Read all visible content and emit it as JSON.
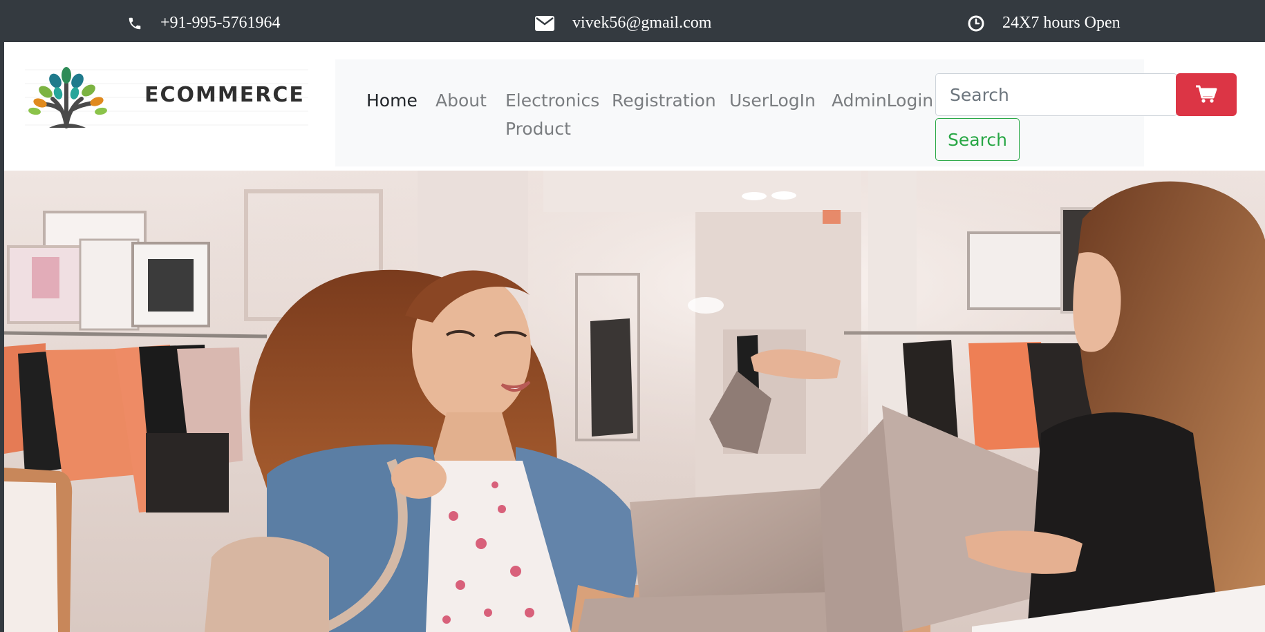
{
  "topbar": {
    "phone": {
      "icon": "phone-icon",
      "text": "+91-995-5761964"
    },
    "email": {
      "icon": "envelope-icon",
      "text": "vivek56@gmail.com"
    },
    "hours": {
      "icon": "clock-icon",
      "text": "24X7 hours Open"
    }
  },
  "brand": {
    "logo_text": "ECOMMERCE"
  },
  "nav": {
    "items": [
      {
        "label": "Home",
        "active": true
      },
      {
        "label": "About",
        "active": false
      },
      {
        "label": "Electronics Product",
        "active": false
      },
      {
        "label": "Registration",
        "active": false
      },
      {
        "label": "UserLogIn",
        "active": false
      },
      {
        "label": "AdminLogin",
        "active": false
      }
    ],
    "electronics_line1": "Electronics",
    "electronics_line2": "Product"
  },
  "search": {
    "placeholder": "Search",
    "button_label": "Search"
  },
  "cart": {
    "icon": "shopping-cart-icon"
  },
  "colors": {
    "topbar_bg": "#343a40",
    "nav_bg": "#f8f9fa",
    "search_button": "#28a745",
    "cart_button": "#dc3545"
  }
}
